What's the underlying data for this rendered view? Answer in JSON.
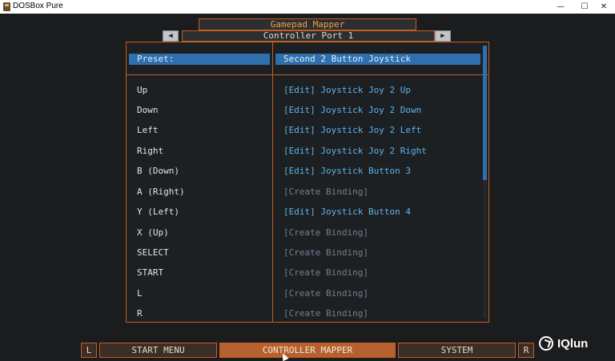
{
  "window": {
    "title": "DOSBox Pure",
    "minimize_glyph": "—",
    "maximize_glyph": "☐",
    "close_glyph": "✕"
  },
  "mapper": {
    "title": "Gamepad Mapper",
    "port": "Controller Port 1",
    "prev_glyph": "◀",
    "next_glyph": "▶",
    "preset_label": "Preset:",
    "preset_value": "Second 2 Button Joystick",
    "rows": [
      {
        "label": "Up",
        "binding": "[Edit] Joystick Joy 2 Up",
        "bound": true
      },
      {
        "label": "Down",
        "binding": "[Edit] Joystick Joy 2 Down",
        "bound": true
      },
      {
        "label": "Left",
        "binding": "[Edit] Joystick Joy 2 Left",
        "bound": true
      },
      {
        "label": "Right",
        "binding": "[Edit] Joystick Joy 2 Right",
        "bound": true
      },
      {
        "label": "B (Down)",
        "binding": "[Edit] Joystick Button 3",
        "bound": true
      },
      {
        "label": "A (Right)",
        "binding": "[Create Binding]",
        "bound": false
      },
      {
        "label": "Y (Left)",
        "binding": "[Edit] Joystick Button 4",
        "bound": true
      },
      {
        "label": "X (Up)",
        "binding": "[Create Binding]",
        "bound": false
      },
      {
        "label": "SELECT",
        "binding": "[Create Binding]",
        "bound": false
      },
      {
        "label": "START",
        "binding": "[Create Binding]",
        "bound": false
      },
      {
        "label": "L",
        "binding": "[Create Binding]",
        "bound": false
      },
      {
        "label": "R",
        "binding": "[Create Binding]",
        "bound": false
      }
    ]
  },
  "bottom_bar": {
    "l": "L",
    "start_menu": "START MENU",
    "controller_mapper": "CONTROLLER MAPPER",
    "system": "SYSTEM",
    "r": "R"
  },
  "watermark": {
    "text": "IQlun"
  },
  "colors": {
    "accent_border": "#c65d22",
    "selection": "#2f6fae",
    "bound_text": "#5fb2e9",
    "unbound_text": "#6f8190"
  }
}
